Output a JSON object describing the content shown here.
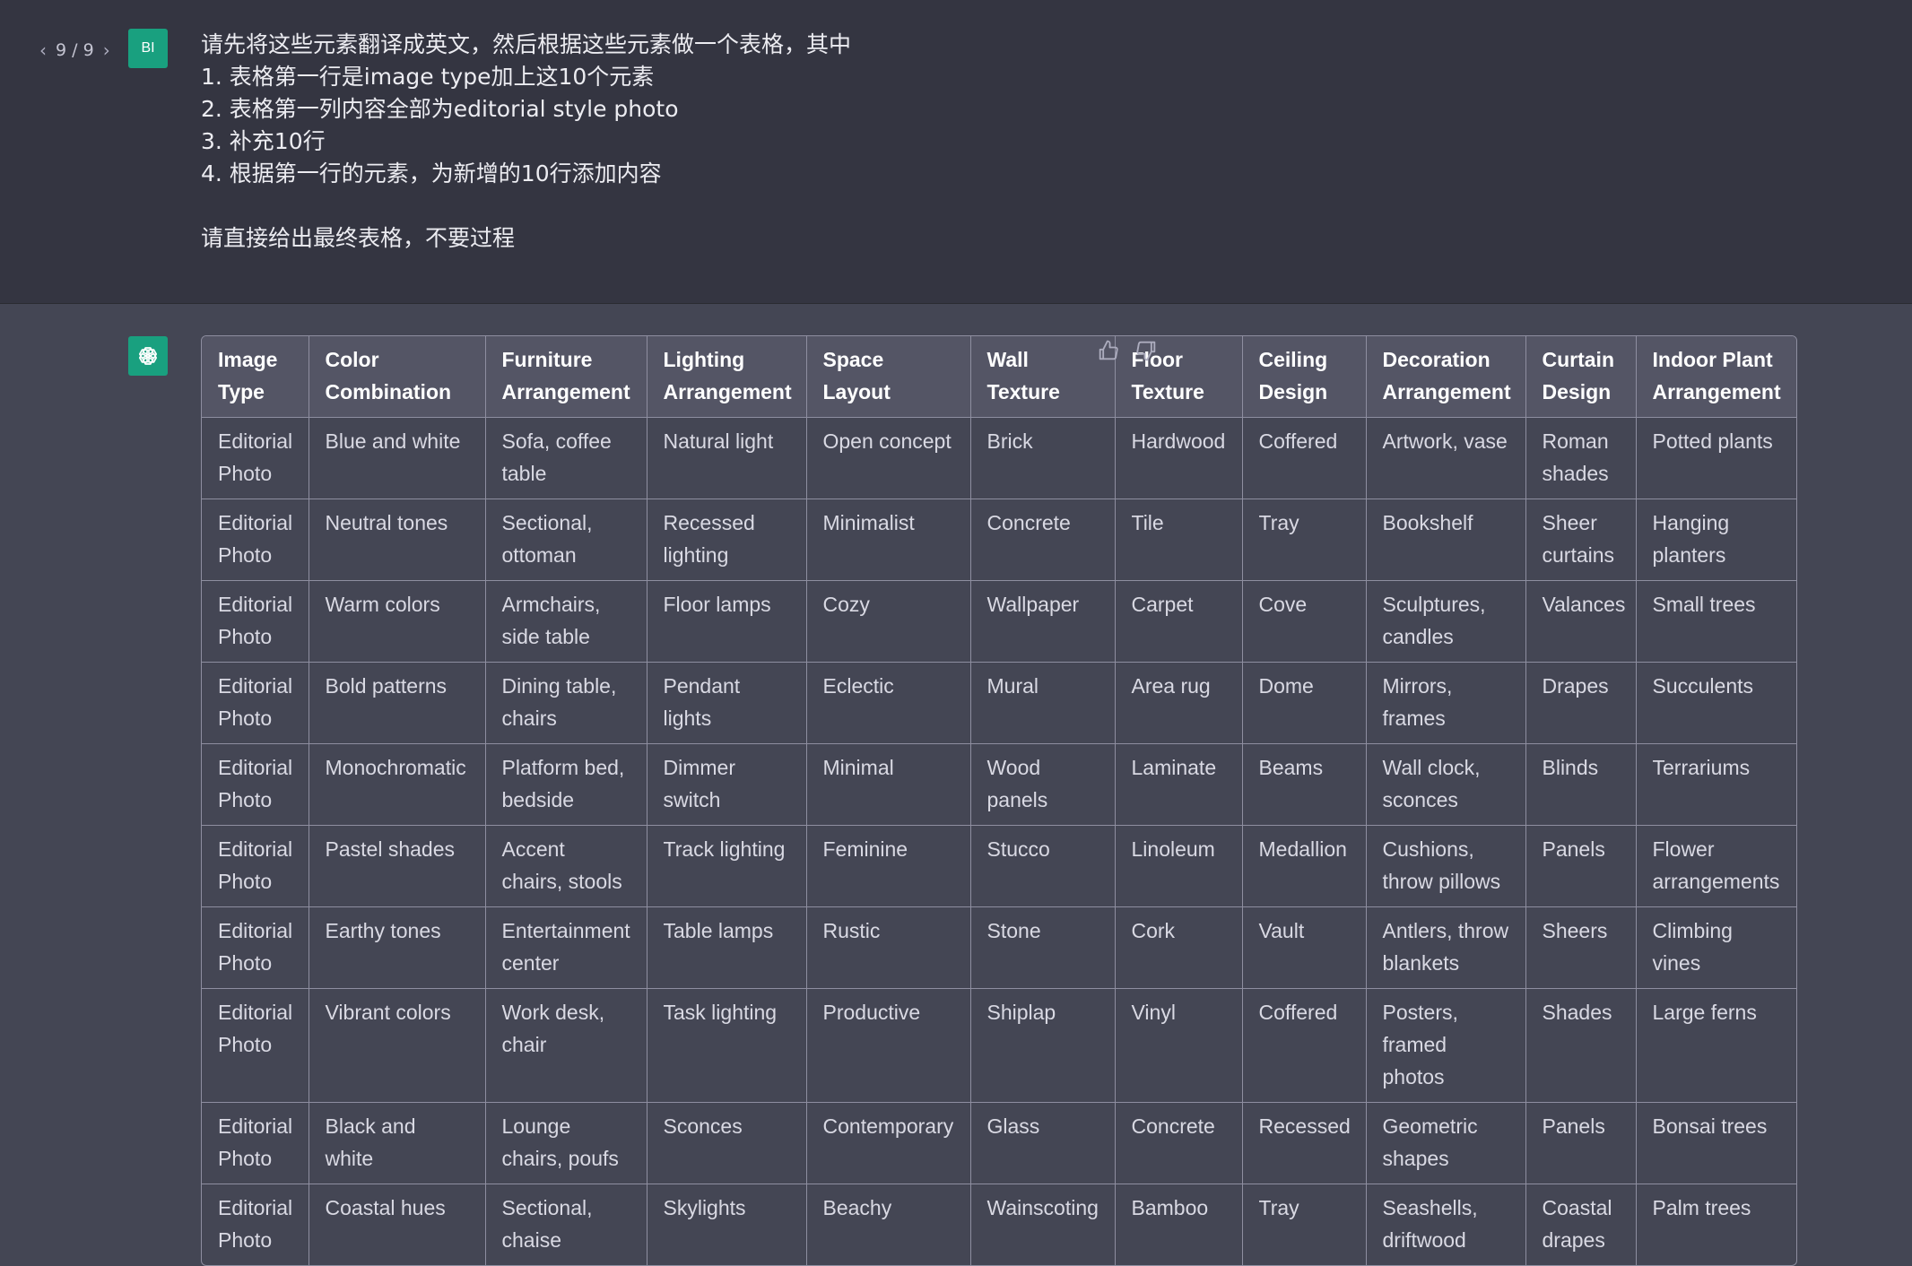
{
  "pager": {
    "current": "9",
    "total": "9",
    "sep": "/"
  },
  "user": {
    "avatar": "BI",
    "prompt_lines": [
      "请先将这些元素翻译成英文，然后根据这些元素做一个表格，其中",
      "1. 表格第一行是image type加上这10个元素",
      "2. 表格第一列内容全部为editorial style photo",
      "3. 补充10行",
      "4. 根据第一行的元素，为新增的10行添加内容",
      "",
      "请直接给出最终表格，不要过程"
    ]
  },
  "assistant": {
    "avatar_icon": "openai-logo-icon",
    "feedback_icons": [
      "thumbs-up-icon",
      "thumbs-down-icon"
    ],
    "table": {
      "headers": [
        "Image Type",
        "Color Combination",
        "Furniture Arrangement",
        "Lighting Arrangement",
        "Space Layout",
        "Wall Texture",
        "Floor Texture",
        "Ceiling Design",
        "Decoration Arrangement",
        "Curtain Design",
        "Indoor Plant Arrangement"
      ],
      "rows": [
        [
          "Editorial Photo",
          "Blue and white",
          "Sofa, coffee table",
          "Natural light",
          "Open concept",
          "Brick",
          "Hardwood",
          "Coffered",
          "Artwork, vase",
          "Roman shades",
          "Potted plants"
        ],
        [
          "Editorial Photo",
          "Neutral tones",
          "Sectional, ottoman",
          "Recessed lighting",
          "Minimalist",
          "Concrete",
          "Tile",
          "Tray",
          "Bookshelf",
          "Sheer curtains",
          "Hanging planters"
        ],
        [
          "Editorial Photo",
          "Warm colors",
          "Armchairs, side table",
          "Floor lamps",
          "Cozy",
          "Wallpaper",
          "Carpet",
          "Cove",
          "Sculptures, candles",
          "Valances",
          "Small trees"
        ],
        [
          "Editorial Photo",
          "Bold patterns",
          "Dining table, chairs",
          "Pendant lights",
          "Eclectic",
          "Mural",
          "Area rug",
          "Dome",
          "Mirrors, frames",
          "Drapes",
          "Succulents"
        ],
        [
          "Editorial Photo",
          "Monochromatic",
          "Platform bed, bedside",
          "Dimmer switch",
          "Minimal",
          "Wood panels",
          "Laminate",
          "Beams",
          "Wall clock, sconces",
          "Blinds",
          "Terrariums"
        ],
        [
          "Editorial Photo",
          "Pastel shades",
          "Accent chairs, stools",
          "Track lighting",
          "Feminine",
          "Stucco",
          "Linoleum",
          "Medallion",
          "Cushions, throw pillows",
          "Panels",
          "Flower arrangements"
        ],
        [
          "Editorial Photo",
          "Earthy tones",
          "Entertainment center",
          "Table lamps",
          "Rustic",
          "Stone",
          "Cork",
          "Vault",
          "Antlers, throw blankets",
          "Sheers",
          "Climbing vines"
        ],
        [
          "Editorial Photo",
          "Vibrant colors",
          "Work desk, chair",
          "Task lighting",
          "Productive",
          "Shiplap",
          "Vinyl",
          "Coffered",
          "Posters, framed photos",
          "Shades",
          "Large ferns"
        ],
        [
          "Editorial Photo",
          "Black and white",
          "Lounge chairs, poufs",
          "Sconces",
          "Contemporary",
          "Glass",
          "Concrete",
          "Recessed",
          "Geometric shapes",
          "Panels",
          "Bonsai trees"
        ],
        [
          "Editorial Photo",
          "Coastal hues",
          "Sectional, chaise",
          "Skylights",
          "Beachy",
          "Wainscoting",
          "Bamboo",
          "Tray",
          "Seashells, driftwood",
          "Coastal drapes",
          "Palm trees"
        ]
      ]
    }
  },
  "colors": {
    "user_bg": "#343541",
    "assistant_bg": "#444654",
    "accent": "#19a07f",
    "header_bg": "#545565",
    "border": "#8e8ea0"
  }
}
